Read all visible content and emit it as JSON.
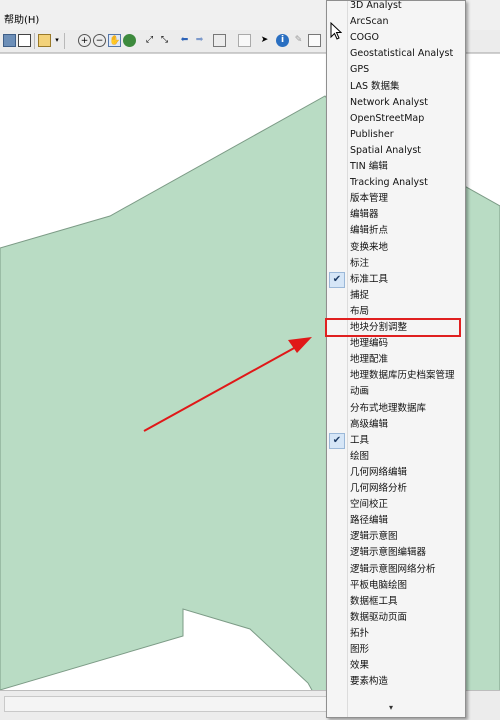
{
  "menubar": {
    "help_label": "帮助(H)"
  },
  "toolbar": {
    "buttons": [
      "copy-icon",
      "frame-icon",
      "identify-icon",
      "dropdown-icon",
      "zoom-in-icon",
      "zoom-out-icon",
      "pan-icon",
      "globe-icon",
      "fixed-zoom-in-icon",
      "fixed-zoom-out-icon",
      "back-icon",
      "forward-icon",
      "select-elements-icon",
      "clear-selection-icon",
      "pointer-icon",
      "info-icon",
      "edit-icon",
      "html-popup-icon"
    ]
  },
  "map": {
    "polygon_fill": "#b9dcc4",
    "polygon_stroke": "#7c9b86",
    "arrow_color": "#e01818"
  },
  "menu": {
    "items": [
      {
        "label": "3D Analyst",
        "checked": false
      },
      {
        "label": "ArcScan",
        "checked": false
      },
      {
        "label": "COGO",
        "checked": false
      },
      {
        "label": "Geostatistical Analyst",
        "checked": false
      },
      {
        "label": "GPS",
        "checked": false
      },
      {
        "label": "LAS 数据集",
        "checked": false
      },
      {
        "label": "Network Analyst",
        "checked": false
      },
      {
        "label": "OpenStreetMap",
        "checked": false
      },
      {
        "label": "Publisher",
        "checked": false
      },
      {
        "label": "Spatial Analyst",
        "checked": false
      },
      {
        "label": "TIN 编辑",
        "checked": false
      },
      {
        "label": "Tracking Analyst",
        "checked": false
      },
      {
        "label": "版本管理",
        "checked": false
      },
      {
        "label": "编辑器",
        "checked": false
      },
      {
        "label": "编辑折点",
        "checked": false
      },
      {
        "label": "变换来地",
        "checked": false
      },
      {
        "label": "标注",
        "checked": false
      },
      {
        "label": "标准工具",
        "checked": true
      },
      {
        "label": "捕捉",
        "checked": false
      },
      {
        "label": "布局",
        "checked": false
      },
      {
        "label": "地块分割调整",
        "checked": false,
        "highlight": true
      },
      {
        "label": "地理编码",
        "checked": false
      },
      {
        "label": "地理配准",
        "checked": false
      },
      {
        "label": "地理数据库历史档案管理",
        "checked": false
      },
      {
        "label": "动画",
        "checked": false
      },
      {
        "label": "分布式地理数据库",
        "checked": false
      },
      {
        "label": "高级编辑",
        "checked": false
      },
      {
        "label": "工具",
        "checked": true
      },
      {
        "label": "绘图",
        "checked": false
      },
      {
        "label": "几何网络编辑",
        "checked": false
      },
      {
        "label": "几何网络分析",
        "checked": false
      },
      {
        "label": "空间校正",
        "checked": false
      },
      {
        "label": "路径编辑",
        "checked": false
      },
      {
        "label": "逻辑示意图",
        "checked": false
      },
      {
        "label": "逻辑示意图编辑器",
        "checked": false
      },
      {
        "label": "逻辑示意图网络分析",
        "checked": false
      },
      {
        "label": "平板电脑绘图",
        "checked": false
      },
      {
        "label": "数据框工具",
        "checked": false
      },
      {
        "label": "数据驱动页面",
        "checked": false
      },
      {
        "label": "拓扑",
        "checked": false
      },
      {
        "label": "图形",
        "checked": false
      },
      {
        "label": "效果",
        "checked": false
      },
      {
        "label": "要素构造",
        "checked": false
      }
    ],
    "more_indicator": "▾",
    "check_glyph": "✔"
  }
}
